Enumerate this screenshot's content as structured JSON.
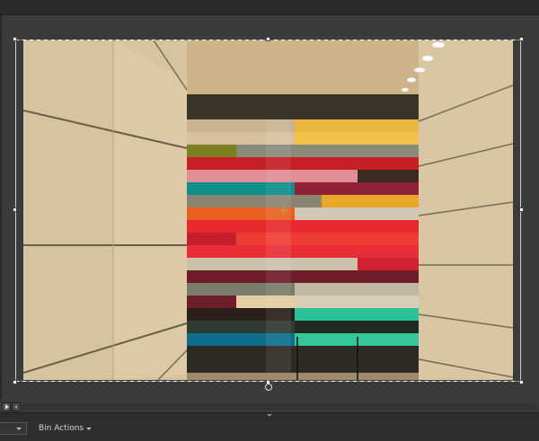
{
  "bottom_bar": {
    "bin_actions_label": "Bin Actions"
  },
  "commit": {
    "confirm_symbol": "✔",
    "cancel_symbol": "⦸"
  },
  "colors": {
    "accent_confirm": "#6cd04e",
    "accent_cancel": "#e0474a"
  },
  "icons": [
    "crosshair-icon",
    "play-icon",
    "scroll-left-icon",
    "chevron-down-icon",
    "commit-check-icon",
    "commit-cancel-icon"
  ]
}
